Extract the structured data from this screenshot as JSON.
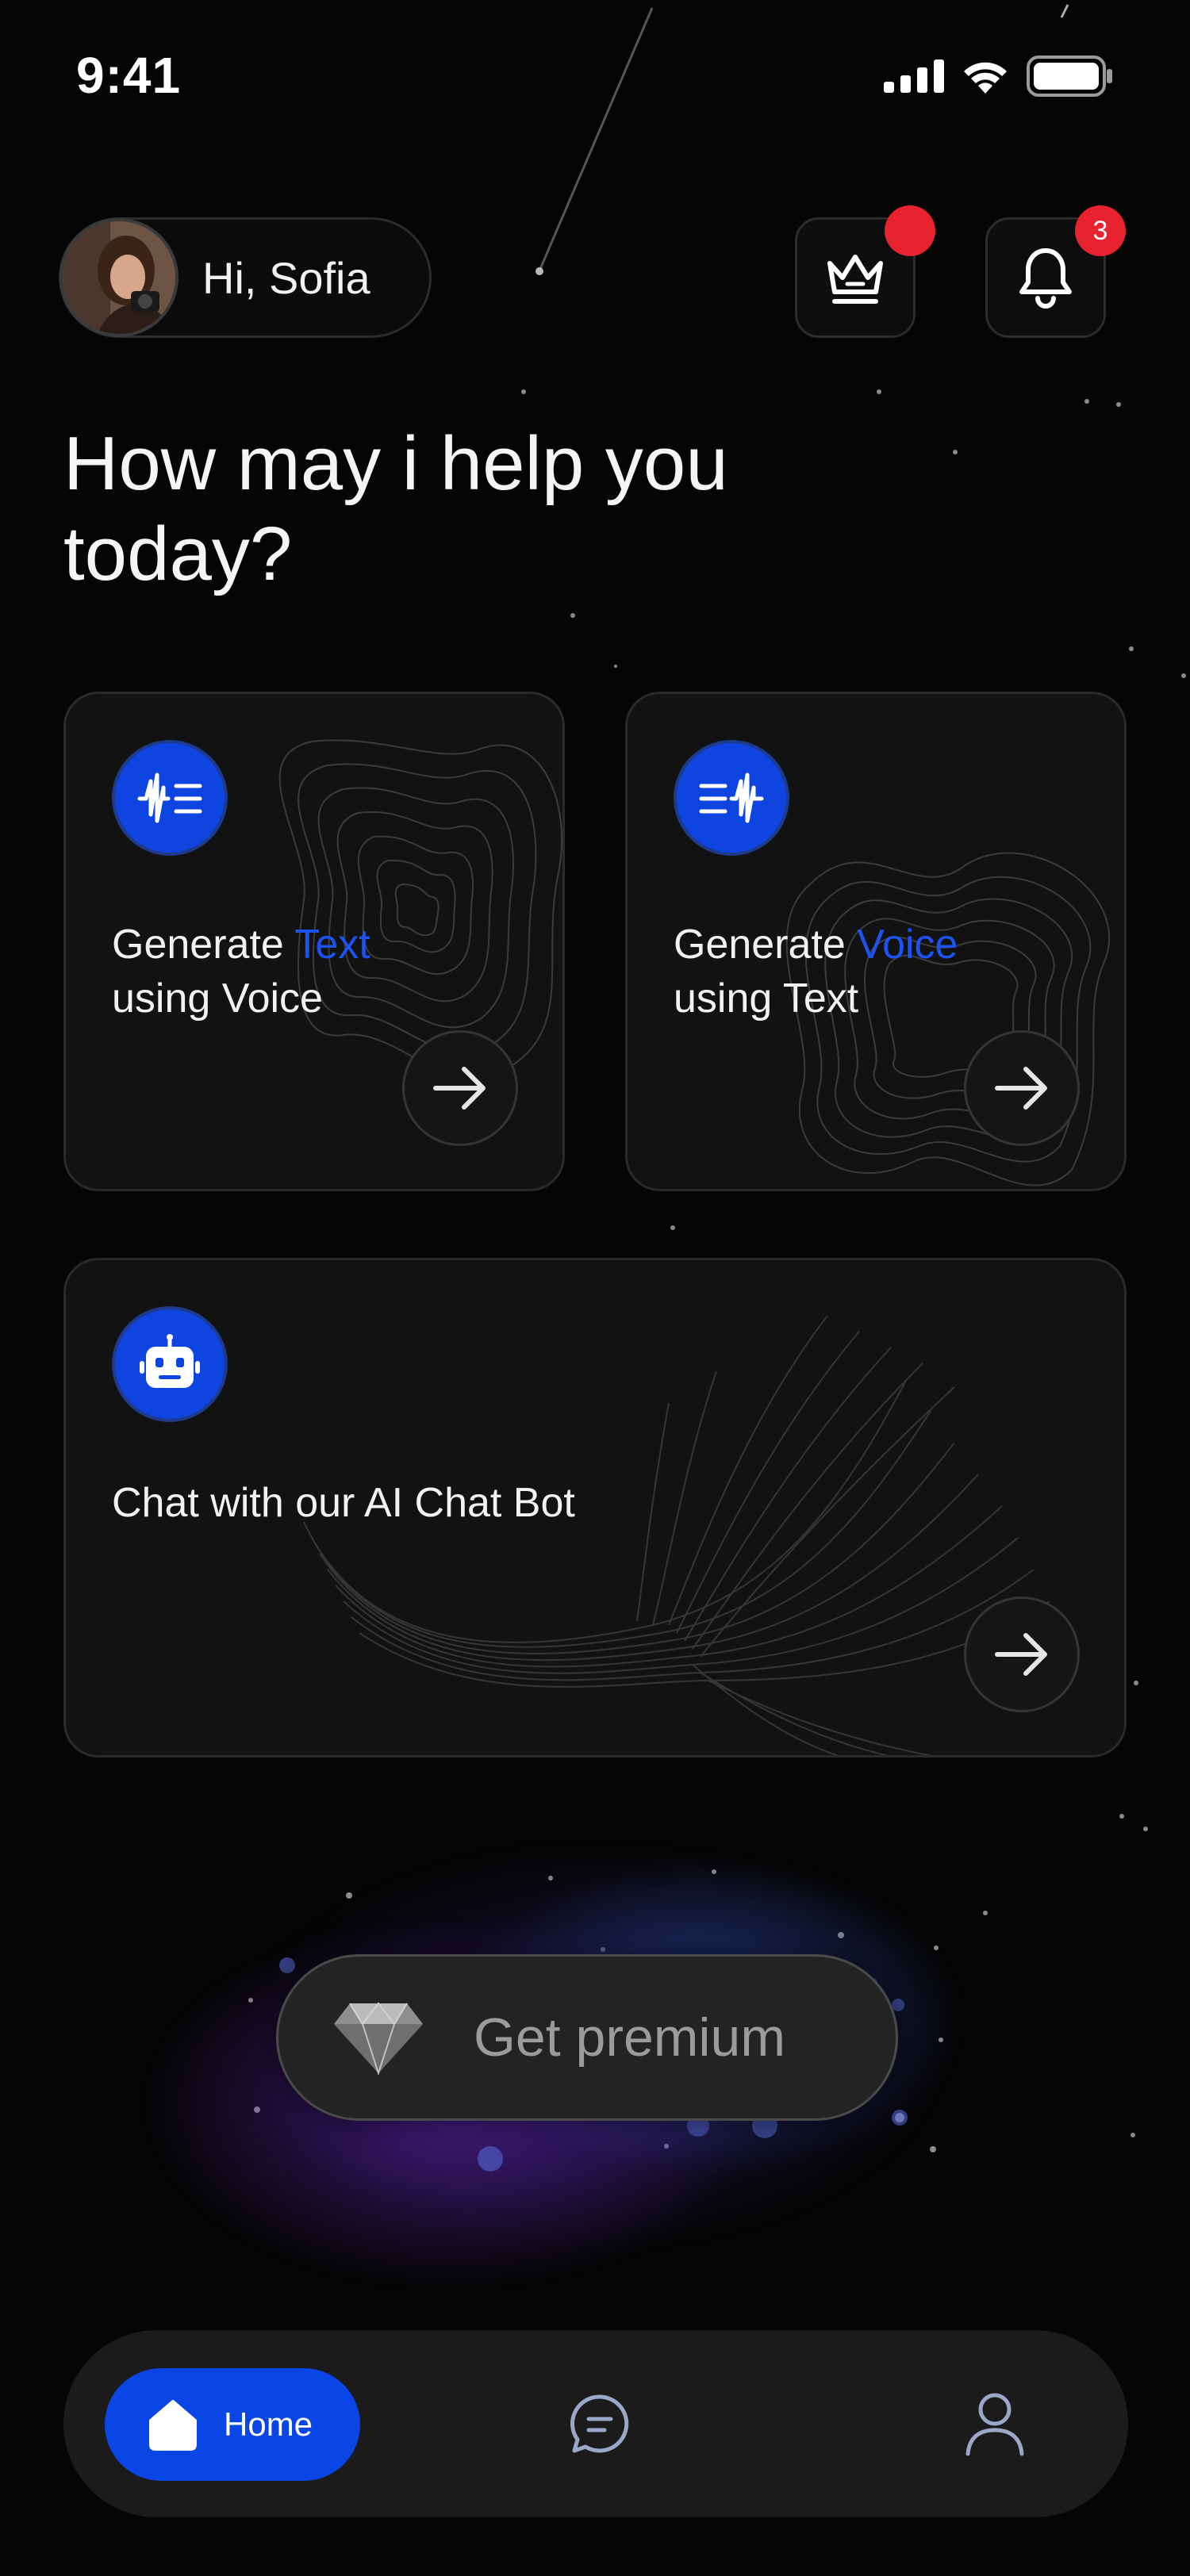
{
  "status_bar": {
    "time": "9:41"
  },
  "header": {
    "greeting": "Hi, Sofia",
    "notification_count": "3"
  },
  "headline": "How may i help you today?",
  "cards": [
    {
      "title_pre": "Generate ",
      "title_accent": "Text",
      "title_line2": "using Voice"
    },
    {
      "title_pre": "Generate ",
      "title_accent": "Voice",
      "title_line2": "using Text"
    },
    {
      "title": "Chat with our AI Chat Bot"
    }
  ],
  "premium": {
    "label": "Get premium"
  },
  "tabbar": {
    "home_label": "Home"
  },
  "colors": {
    "accent": "#1c52f0",
    "primary_button": "#0a45e6",
    "badge": "#e9222f",
    "background": "#050505"
  }
}
